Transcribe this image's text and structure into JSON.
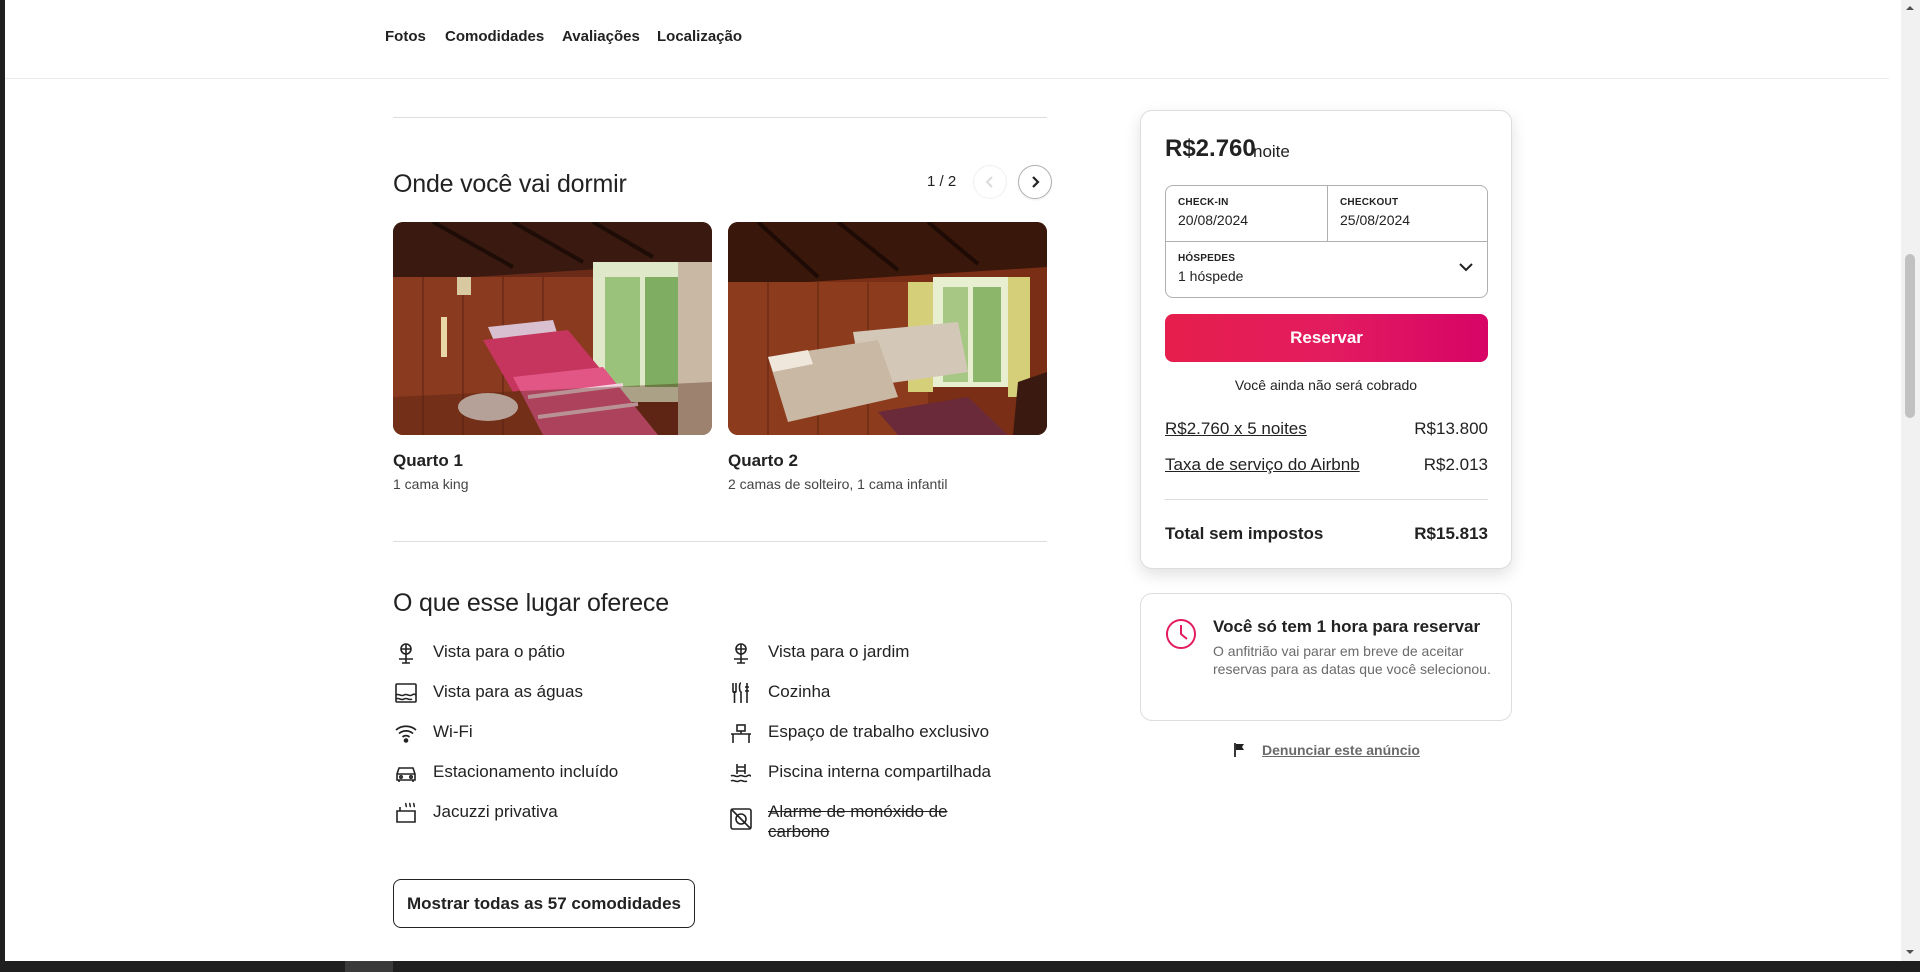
{
  "nav": {
    "links": [
      "Fotos",
      "Comodidades",
      "Avaliações",
      "Localização"
    ]
  },
  "sleep": {
    "title": "Onde você vai dormir",
    "pager": "1 / 2",
    "rooms": [
      {
        "name": "Quarto 1",
        "desc": "1 cama king"
      },
      {
        "name": "Quarto 2",
        "desc": "2 camas de solteiro, 1 cama infantil"
      }
    ]
  },
  "amenities": {
    "title": "O que esse lugar oferece",
    "items": [
      {
        "label": "Vista para o pátio",
        "icon": "patio-view-icon"
      },
      {
        "label": "Vista para o jardim",
        "icon": "garden-view-icon"
      },
      {
        "label": "Vista para as águas",
        "icon": "water-view-icon"
      },
      {
        "label": "Cozinha",
        "icon": "kitchen-icon"
      },
      {
        "label": "Wi-Fi",
        "icon": "wifi-icon"
      },
      {
        "label": "Espaço de trabalho exclusivo",
        "icon": "workspace-icon"
      },
      {
        "label": "Estacionamento incluído",
        "icon": "car-icon"
      },
      {
        "label": "Piscina interna compartilhada",
        "icon": "pool-icon"
      },
      {
        "label": "Jacuzzi privativa",
        "icon": "hot-tub-icon"
      },
      {
        "label": "Alarme de monóxido de carbono",
        "icon": "co-alarm-icon",
        "unavailable": true
      }
    ],
    "show_all": "Mostrar todas as 57 comodidades"
  },
  "booking": {
    "price": "R$2.760",
    "price_unit": "noite",
    "checkin_label": "CHECK-IN",
    "checkin_value": "20/08/2024",
    "checkout_label": "CHECKOUT",
    "checkout_value": "25/08/2024",
    "guests_label": "HÓSPEDES",
    "guests_value": "1 hóspede",
    "reserve": "Reservar",
    "no_charge": "Você ainda não será cobrado",
    "nights_label": "R$2.760 x 5 noites",
    "nights_value": "R$13.800",
    "fee_label": "Taxa de serviço do Airbnb",
    "fee_value": "R$2.013",
    "total_label": "Total sem impostos",
    "total_value": "R$15.813"
  },
  "notice": {
    "title": "Você só tem 1 hora para reservar",
    "text": "O anfitrião vai parar em breve de aceitar reservas para as datas que você selecionou."
  },
  "report": "Denunciar este anúncio",
  "colors": {
    "brand": "#e31c5f",
    "text": "#222222",
    "muted": "#6a6a6a",
    "border": "#dddddd"
  }
}
